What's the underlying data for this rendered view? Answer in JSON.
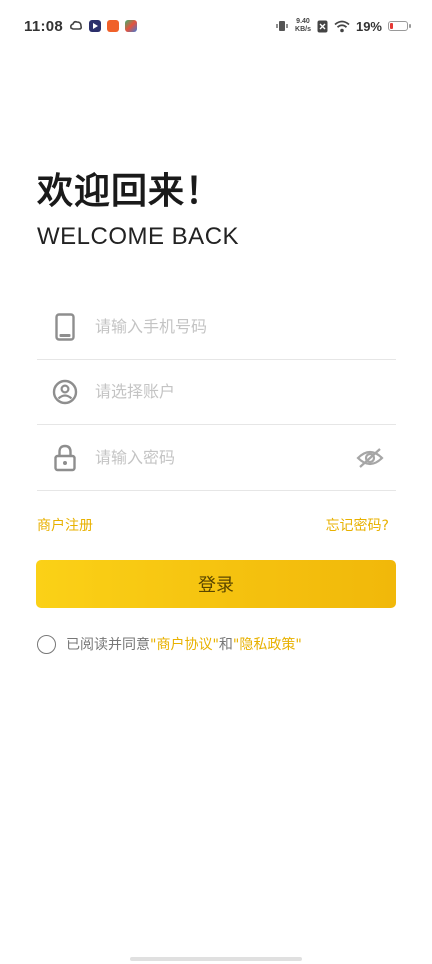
{
  "status_bar": {
    "time": "11:08",
    "network_speed_value": "9.40",
    "network_speed_unit": "KB/s",
    "battery_percent": "19%",
    "battery_level": 0.19,
    "app_icons": [
      "cloud-app-icon",
      "video-app-icon",
      "orange-app-icon",
      "game-app-icon"
    ],
    "colors": {
      "battery_low": "#e53935"
    }
  },
  "header": {
    "title": "欢迎回来！",
    "subtitle": "WELCOME BACK"
  },
  "form": {
    "phone": {
      "placeholder": "请输入手机号码",
      "icon": "phone-icon"
    },
    "account": {
      "placeholder": "请选择账户",
      "icon": "user-circle-icon"
    },
    "password": {
      "placeholder": "请输入密码",
      "icon": "lock-icon",
      "toggle_icon": "eye-off-icon"
    }
  },
  "links": {
    "register": "商户注册",
    "forgot_password": "忘记密码?"
  },
  "login_button": {
    "label": "登录"
  },
  "agreement": {
    "prefix": "已阅读并同意",
    "merchant_agreement": "\"商户协议\"",
    "conjunction": "和",
    "privacy_policy": "\"隐私政策\""
  },
  "colors": {
    "accent": "#e8b100",
    "button_gradient_start": "#fbd117",
    "button_gradient_end": "#f1b80a",
    "placeholder": "#c4c4c4",
    "divider": "#e6e6e6"
  }
}
